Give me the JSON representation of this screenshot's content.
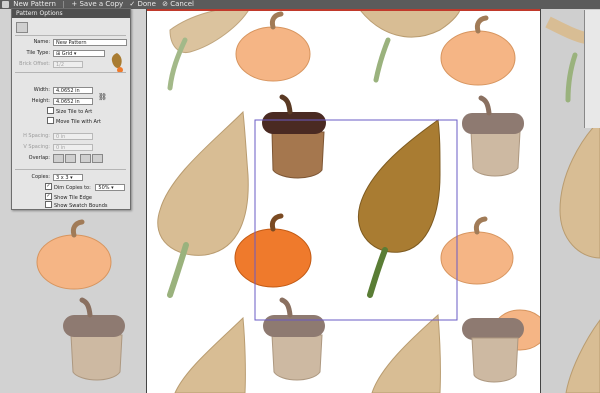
{
  "toolbar": {
    "pattern_name": "New Pattern",
    "save_copy_label": "Save a Copy",
    "done_label": "Done",
    "cancel_label": "Cancel"
  },
  "panel": {
    "title": "Pattern Options",
    "name_label": "Name:",
    "name_value": "New Pattern",
    "tile_type_label": "Tile Type:",
    "tile_type_value": "Grid",
    "brick_offset_label": "Brick Offset:",
    "brick_offset_value": "1/2",
    "width_label": "Width:",
    "width_value": "4.0652 in",
    "height_label": "Height:",
    "height_value": "4.0652 in",
    "size_tile_label": "Size Tile to Art",
    "move_tile_label": "Move Tile with Art",
    "h_spacing_label": "H Spacing:",
    "h_spacing_value": "0 in",
    "v_spacing_label": "V Spacing:",
    "v_spacing_value": "0 in",
    "overlap_label": "Overlap:",
    "copies_label": "Copies:",
    "copies_value": "3 x 3",
    "dim_copies_label": "Dim Copies to:",
    "dim_copies_value": "50%",
    "show_tile_edge_label": "Show Tile Edge",
    "show_swatch_bounds_label": "Show Swatch Bounds",
    "dim_copies_checked": true,
    "show_tile_edge_checked": true,
    "show_swatch_bounds_checked": false
  },
  "colors": {
    "leaf": "#d8bd94",
    "leaf_dark": "#a97c32",
    "pumpkin": "#f5b585",
    "pumpkin_dark": "#ef7a2c",
    "acorn_cap": "#8e7a71",
    "acorn_cap_dark": "#4a2a22",
    "acorn_body": "#cdb9a2",
    "acorn_body_dark": "#a5774e",
    "tile_edge": "#6a5bc4"
  }
}
